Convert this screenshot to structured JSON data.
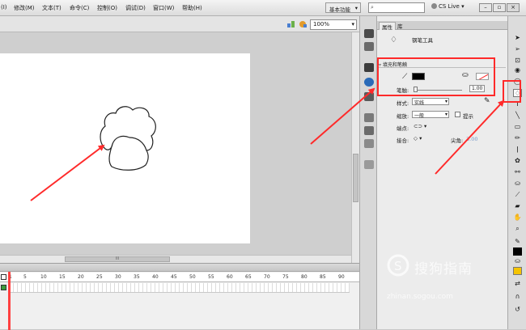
{
  "menu": {
    "items": [
      "(I)",
      "修改(M)",
      "文本(T)",
      "命令(C)",
      "控制(O)",
      "调试(D)",
      "窗口(W)",
      "帮助(H)"
    ],
    "workspace": "基本功能",
    "search_icon": "search-icon",
    "cs_live": "CS Live"
  },
  "stage": {
    "zoom": "100%",
    "hscroll_label": "III"
  },
  "timeline": {
    "frames": [
      "1",
      "5",
      "10",
      "15",
      "20",
      "25",
      "30",
      "35",
      "40",
      "45",
      "50",
      "55",
      "60",
      "65",
      "70",
      "75",
      "80",
      "85",
      "90"
    ]
  },
  "panel": {
    "tabs": [
      "属性",
      "库"
    ],
    "tool_name": "钢笔工具",
    "section_fill": "填充和笔触",
    "stroke_label": "笔触:",
    "stroke_value": "1.00",
    "style_label": "样式:",
    "style_value": "实线",
    "scale_label": "缩放:",
    "scale_value": "一般",
    "hint_label": "提示",
    "cap_label": "端点:",
    "join_label": "接合:",
    "miter_label": "尖角:",
    "miter_value": "3.00"
  },
  "watermark": {
    "title": "搜狗指南",
    "url": "zhinan.sogou.com"
  },
  "colors": {
    "annotation": "#ff2a2a",
    "stroke_color": "#000000"
  }
}
